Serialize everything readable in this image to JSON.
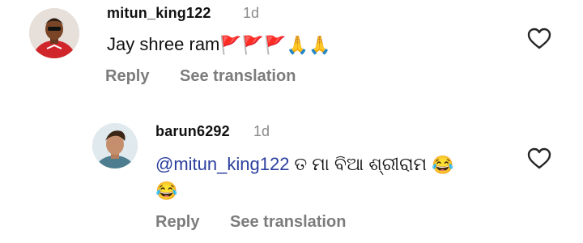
{
  "comments": [
    {
      "username": "mitun_king122",
      "time": "1d",
      "text": "Jay shree ram",
      "emojis": [
        "🚩",
        "🚩",
        "🚩",
        "🙏",
        "🙏"
      ],
      "reply_label": "Reply",
      "translate_label": "See translation"
    },
    {
      "username": "barun6292",
      "time": "1d",
      "mention": "@mitun_king122",
      "text": " ତ ମା ବିଆ ଶ୍ରୀରାମ ",
      "emojis": [
        "😂",
        "😂"
      ],
      "reply_label": "Reply",
      "translate_label": "See translation"
    }
  ],
  "colors": {
    "mention": "#2b3f9e",
    "muted": "#7c7c7c",
    "heart_stroke": "#262626"
  }
}
